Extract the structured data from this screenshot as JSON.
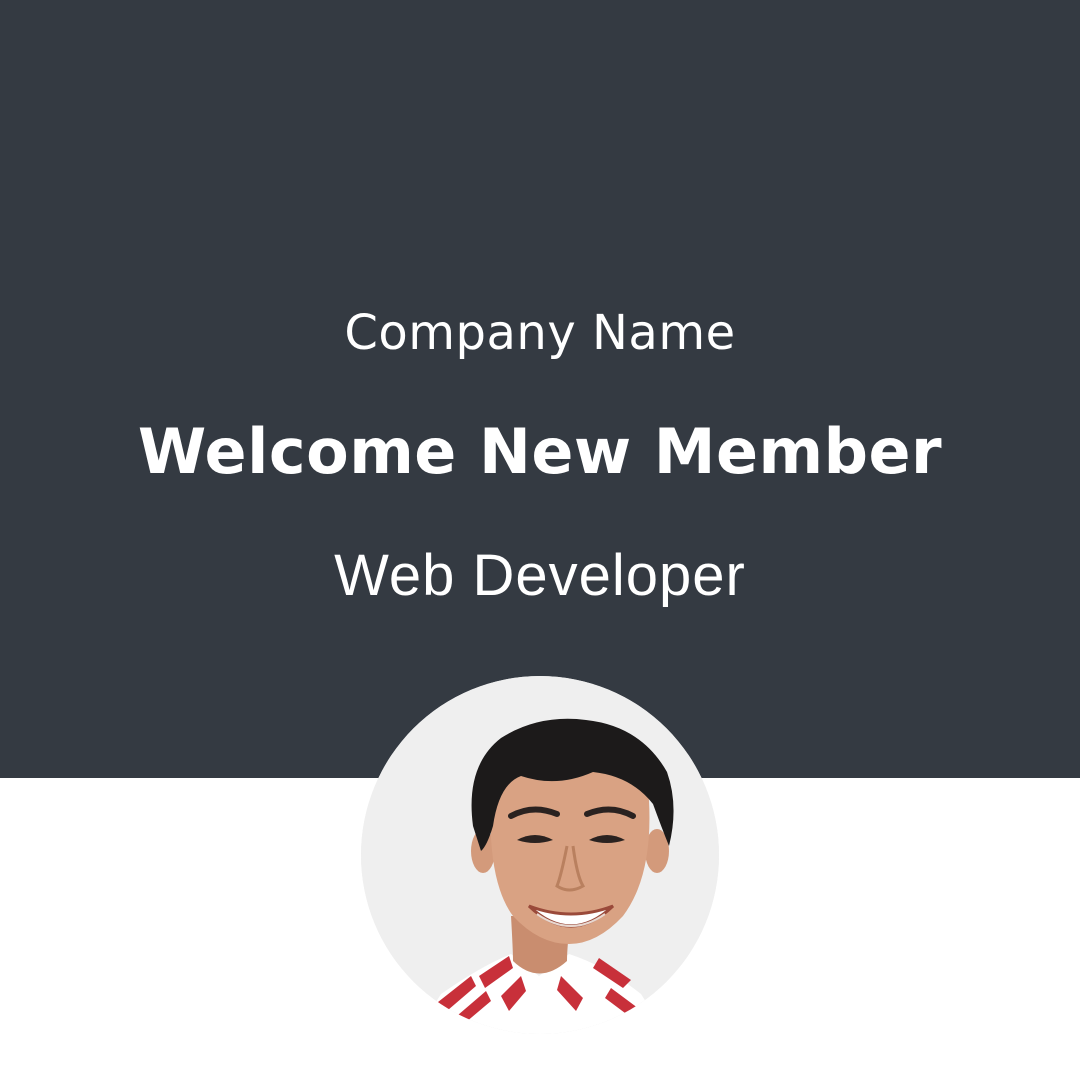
{
  "company_name": "Company Name",
  "headline": "Welcome New Member",
  "role": "Web Developer",
  "photo": {
    "icon": "member-portrait-photo"
  },
  "colors": {
    "banner": "#343a42",
    "page_background": "#ffffff",
    "text": "#ffffff",
    "photo_background": "#efefef",
    "hair": "#1c1a1a",
    "skin": "#d9a283",
    "shirt_red": "#c8303a"
  }
}
